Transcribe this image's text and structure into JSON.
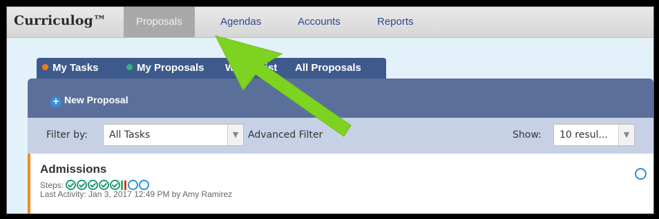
{
  "brand": "Curriculog™",
  "nav": [
    {
      "label": "Proposals",
      "active": true
    },
    {
      "label": "Agendas",
      "active": false
    },
    {
      "label": "Accounts",
      "active": false
    },
    {
      "label": "Reports",
      "active": false
    }
  ],
  "tabs": [
    {
      "label": "My Tasks",
      "dot_color": "#f07d1a"
    },
    {
      "label": "My Proposals",
      "dot_color": "#2fb57a"
    },
    {
      "label": "Watch List",
      "dot_color": null
    },
    {
      "label": "All Proposals",
      "dot_color": null
    }
  ],
  "toolbar": {
    "new_proposal": "New Proposal"
  },
  "filter": {
    "label": "Filter by:",
    "selected": "All Tasks",
    "advanced": "Advanced Filter",
    "show_label": "Show:",
    "show_selected": "10 resul..."
  },
  "task": {
    "title": "Admissions",
    "steps_label": "Steps:",
    "activity": "Last Activity: Jan 3, 2017 12:49 PM by Amy Ramirez"
  },
  "colors": {
    "accent_orange": "#f08c1e",
    "annotation_arrow": "#7ed321"
  }
}
